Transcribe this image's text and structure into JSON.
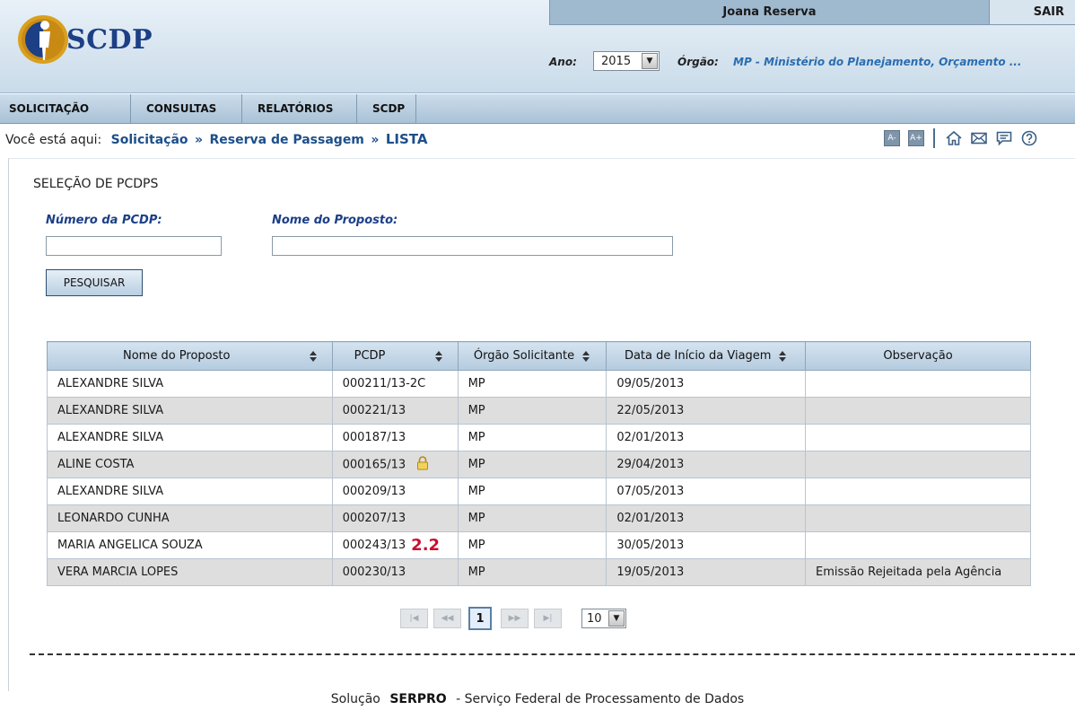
{
  "app": {
    "logo_text": "SCDP"
  },
  "userbar": {
    "user_name": "Joana Reserva",
    "logout": "SAIR"
  },
  "filters": {
    "ano_label": "Ano:",
    "ano_value": "2015",
    "orgao_label": "Órgão:",
    "orgao_value": "MP - Ministério do Planejamento, Orçamento ..."
  },
  "menu": [
    {
      "label": "SOLICITAÇÃO"
    },
    {
      "label": "CONSULTAS"
    },
    {
      "label": "RELATÓRIOS"
    },
    {
      "label": "SCDP"
    }
  ],
  "breadcrumb": {
    "prefix": "Você está aqui:",
    "items": [
      "Solicitação",
      "Reserva de Passagem"
    ],
    "separator": "»",
    "current": "LISTA"
  },
  "tools": {
    "font_decrease": "A-",
    "font_increase": "A+"
  },
  "search": {
    "title": "SELEÇÃO DE PCDPS",
    "numero_label": "Número da PCDP:",
    "numero_value": "",
    "nome_label": "Nome do Proposto:",
    "nome_value": "",
    "button": "PESQUISAR"
  },
  "table": {
    "columns": [
      "Nome do Proposto",
      "PCDP",
      "Órgão Solicitante",
      "Data de Início da Viagem",
      "Observação"
    ],
    "rows": [
      {
        "nome": "ALEXANDRE SILVA",
        "pcdp": "000211/13-2C",
        "orgao": "MP",
        "data": "09/05/2013",
        "obs": ""
      },
      {
        "nome": "ALEXANDRE SILVA",
        "pcdp": "000221/13",
        "orgao": "MP",
        "data": "22/05/2013",
        "obs": ""
      },
      {
        "nome": "ALEXANDRE SILVA",
        "pcdp": "000187/13",
        "orgao": "MP",
        "data": "02/01/2013",
        "obs": ""
      },
      {
        "nome": "ALINE COSTA",
        "pcdp": "000165/13",
        "orgao": "MP",
        "data": "29/04/2013",
        "obs": ""
      },
      {
        "nome": "ALEXANDRE SILVA",
        "pcdp": "000209/13",
        "orgao": "MP",
        "data": "07/05/2013",
        "obs": ""
      },
      {
        "nome": "LEONARDO CUNHA",
        "pcdp": "000207/13",
        "orgao": "MP",
        "data": "02/01/2013",
        "obs": ""
      },
      {
        "nome": "MARIA ANGELICA SOUZA",
        "pcdp": "000243/13",
        "orgao": "MP",
        "data": "30/05/2013",
        "obs": ""
      },
      {
        "nome": "VERA MARCIA LOPES",
        "pcdp": "000230/13",
        "orgao": "MP",
        "data": "19/05/2013",
        "obs": "Emissão Rejeitada pela Agência"
      }
    ],
    "lock_row": 3,
    "badge_row": 6,
    "badge_text": "2.2"
  },
  "pager": {
    "current_page": "1",
    "page_size": "10"
  },
  "footer": {
    "prefix": "Solução",
    "brand": "SERPRO",
    "suffix": "- Serviço Federal de Processamento de Dados"
  },
  "colors": {
    "accent": "#1c4f8a",
    "header_bg": "#c9dbe9",
    "badge": "#c8102e"
  }
}
